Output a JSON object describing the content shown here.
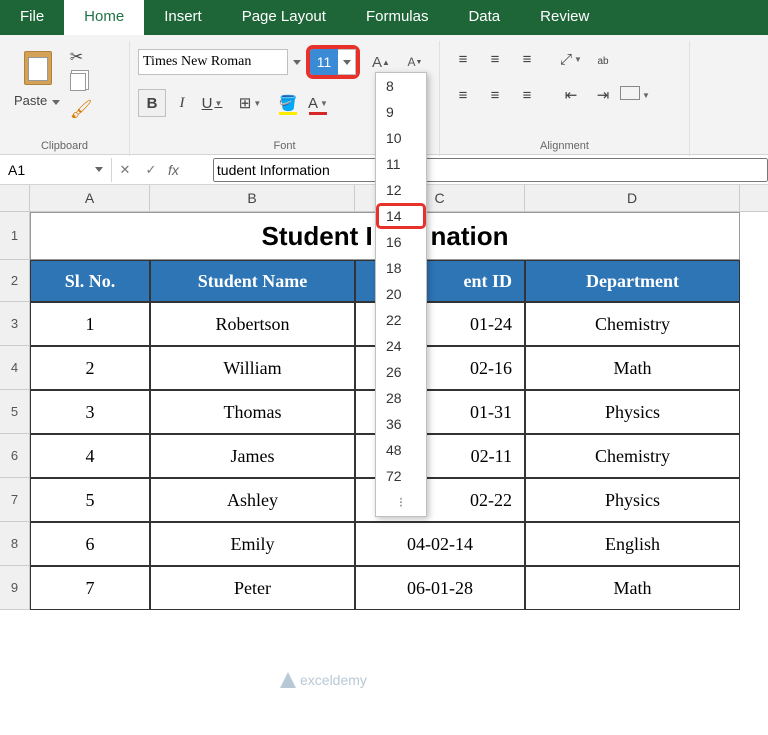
{
  "tabs": [
    "File",
    "Home",
    "Insert",
    "Page Layout",
    "Formulas",
    "Data",
    "Review"
  ],
  "tabs_active": 1,
  "ribbon": {
    "clipboard_label": "Clipboard",
    "paste_label": "Paste",
    "font_label": "Font",
    "alignment_label": "Alignment",
    "font_name": "Times New Roman",
    "font_size": "11",
    "bold": "B",
    "italic": "I",
    "underline": "U",
    "grow": "A",
    "shrink": "A"
  },
  "size_list": [
    "8",
    "9",
    "10",
    "11",
    "12",
    "14",
    "16",
    "18",
    "20",
    "22",
    "24",
    "26",
    "28",
    "36",
    "48",
    "72"
  ],
  "size_highlight": "14",
  "namebox": "A1",
  "formula": "tudent Information",
  "sheet_title": "Student I        nation",
  "cols": [
    "A",
    "B",
    "C",
    "D"
  ],
  "headers": {
    "sl": "Sl. No.",
    "name": "Student Name",
    "id": "ent ID",
    "dept": "Department"
  },
  "rows": [
    {
      "sl": "1",
      "name": "Robertson",
      "id": "01-24",
      "dept": "Chemistry"
    },
    {
      "sl": "2",
      "name": "William",
      "id": "02-16",
      "dept": "Math"
    },
    {
      "sl": "3",
      "name": "Thomas",
      "id": "01-31",
      "dept": "Physics"
    },
    {
      "sl": "4",
      "name": "James",
      "id": "02-11",
      "dept": "Chemistry"
    },
    {
      "sl": "5",
      "name": "Ashley",
      "id": "02-22",
      "dept": "Physics"
    },
    {
      "sl": "6",
      "name": "Emily",
      "id": "04-02-14",
      "dept": "English"
    },
    {
      "sl": "7",
      "name": "Peter",
      "id": "06-01-28",
      "dept": "Math"
    }
  ],
  "watermark": "exceldemy"
}
